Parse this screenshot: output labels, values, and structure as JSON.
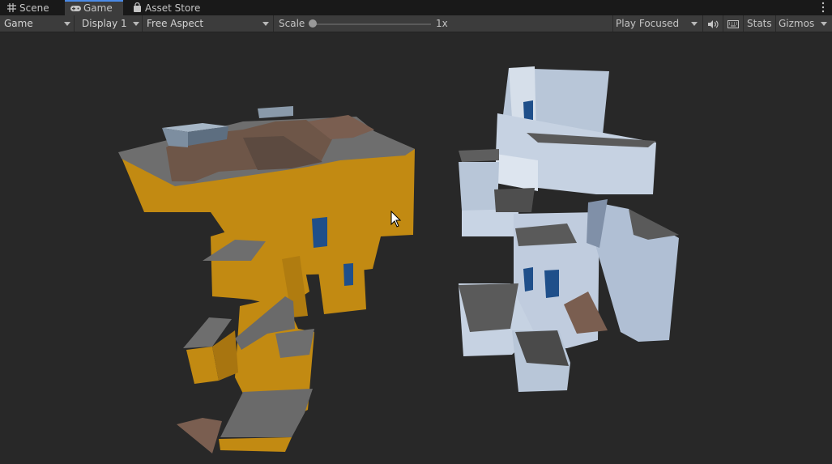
{
  "tabs": [
    {
      "label": "Scene",
      "icon": "grid-icon",
      "active": false
    },
    {
      "label": "Game",
      "icon": "gamepad-icon",
      "active": true
    },
    {
      "label": "Asset Store",
      "icon": "shopping-bag-icon",
      "active": false
    }
  ],
  "toolbar": {
    "view_mode": "Game",
    "display": "Display 1",
    "aspect": "Free Aspect",
    "scale_label": "Scale",
    "scale_value": "1x",
    "scale_level": 0,
    "play_mode": "Play Focused",
    "stats_label": "Stats",
    "gizmos_label": "Gizmos"
  },
  "colors": {
    "accent": "#4a8be8",
    "building_left_wall": "#c28a12",
    "building_right_wall": "#b9c8dc",
    "roof": "#6b5548",
    "ledge": "#6a6a6a",
    "background": "#282828"
  }
}
